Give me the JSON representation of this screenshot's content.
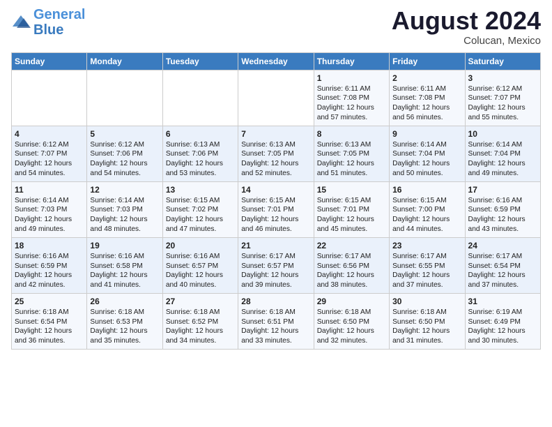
{
  "header": {
    "logo_line1": "General",
    "logo_line2": "Blue",
    "main_title": "August 2024",
    "subtitle": "Colucan, Mexico"
  },
  "days_of_week": [
    "Sunday",
    "Monday",
    "Tuesday",
    "Wednesday",
    "Thursday",
    "Friday",
    "Saturday"
  ],
  "weeks": [
    [
      {
        "day": "",
        "text": ""
      },
      {
        "day": "",
        "text": ""
      },
      {
        "day": "",
        "text": ""
      },
      {
        "day": "",
        "text": ""
      },
      {
        "day": "1",
        "text": "Sunrise: 6:11 AM\nSunset: 7:08 PM\nDaylight: 12 hours and 57 minutes."
      },
      {
        "day": "2",
        "text": "Sunrise: 6:11 AM\nSunset: 7:08 PM\nDaylight: 12 hours and 56 minutes."
      },
      {
        "day": "3",
        "text": "Sunrise: 6:12 AM\nSunset: 7:07 PM\nDaylight: 12 hours and 55 minutes."
      }
    ],
    [
      {
        "day": "4",
        "text": "Sunrise: 6:12 AM\nSunset: 7:07 PM\nDaylight: 12 hours and 54 minutes."
      },
      {
        "day": "5",
        "text": "Sunrise: 6:12 AM\nSunset: 7:06 PM\nDaylight: 12 hours and 54 minutes."
      },
      {
        "day": "6",
        "text": "Sunrise: 6:13 AM\nSunset: 7:06 PM\nDaylight: 12 hours and 53 minutes."
      },
      {
        "day": "7",
        "text": "Sunrise: 6:13 AM\nSunset: 7:05 PM\nDaylight: 12 hours and 52 minutes."
      },
      {
        "day": "8",
        "text": "Sunrise: 6:13 AM\nSunset: 7:05 PM\nDaylight: 12 hours and 51 minutes."
      },
      {
        "day": "9",
        "text": "Sunrise: 6:14 AM\nSunset: 7:04 PM\nDaylight: 12 hours and 50 minutes."
      },
      {
        "day": "10",
        "text": "Sunrise: 6:14 AM\nSunset: 7:04 PM\nDaylight: 12 hours and 49 minutes."
      }
    ],
    [
      {
        "day": "11",
        "text": "Sunrise: 6:14 AM\nSunset: 7:03 PM\nDaylight: 12 hours and 49 minutes."
      },
      {
        "day": "12",
        "text": "Sunrise: 6:14 AM\nSunset: 7:03 PM\nDaylight: 12 hours and 48 minutes."
      },
      {
        "day": "13",
        "text": "Sunrise: 6:15 AM\nSunset: 7:02 PM\nDaylight: 12 hours and 47 minutes."
      },
      {
        "day": "14",
        "text": "Sunrise: 6:15 AM\nSunset: 7:01 PM\nDaylight: 12 hours and 46 minutes."
      },
      {
        "day": "15",
        "text": "Sunrise: 6:15 AM\nSunset: 7:01 PM\nDaylight: 12 hours and 45 minutes."
      },
      {
        "day": "16",
        "text": "Sunrise: 6:15 AM\nSunset: 7:00 PM\nDaylight: 12 hours and 44 minutes."
      },
      {
        "day": "17",
        "text": "Sunrise: 6:16 AM\nSunset: 6:59 PM\nDaylight: 12 hours and 43 minutes."
      }
    ],
    [
      {
        "day": "18",
        "text": "Sunrise: 6:16 AM\nSunset: 6:59 PM\nDaylight: 12 hours and 42 minutes."
      },
      {
        "day": "19",
        "text": "Sunrise: 6:16 AM\nSunset: 6:58 PM\nDaylight: 12 hours and 41 minutes."
      },
      {
        "day": "20",
        "text": "Sunrise: 6:16 AM\nSunset: 6:57 PM\nDaylight: 12 hours and 40 minutes."
      },
      {
        "day": "21",
        "text": "Sunrise: 6:17 AM\nSunset: 6:57 PM\nDaylight: 12 hours and 39 minutes."
      },
      {
        "day": "22",
        "text": "Sunrise: 6:17 AM\nSunset: 6:56 PM\nDaylight: 12 hours and 38 minutes."
      },
      {
        "day": "23",
        "text": "Sunrise: 6:17 AM\nSunset: 6:55 PM\nDaylight: 12 hours and 37 minutes."
      },
      {
        "day": "24",
        "text": "Sunrise: 6:17 AM\nSunset: 6:54 PM\nDaylight: 12 hours and 37 minutes."
      }
    ],
    [
      {
        "day": "25",
        "text": "Sunrise: 6:18 AM\nSunset: 6:54 PM\nDaylight: 12 hours and 36 minutes."
      },
      {
        "day": "26",
        "text": "Sunrise: 6:18 AM\nSunset: 6:53 PM\nDaylight: 12 hours and 35 minutes."
      },
      {
        "day": "27",
        "text": "Sunrise: 6:18 AM\nSunset: 6:52 PM\nDaylight: 12 hours and 34 minutes."
      },
      {
        "day": "28",
        "text": "Sunrise: 6:18 AM\nSunset: 6:51 PM\nDaylight: 12 hours and 33 minutes."
      },
      {
        "day": "29",
        "text": "Sunrise: 6:18 AM\nSunset: 6:50 PM\nDaylight: 12 hours and 32 minutes."
      },
      {
        "day": "30",
        "text": "Sunrise: 6:18 AM\nSunset: 6:50 PM\nDaylight: 12 hours and 31 minutes."
      },
      {
        "day": "31",
        "text": "Sunrise: 6:19 AM\nSunset: 6:49 PM\nDaylight: 12 hours and 30 minutes."
      }
    ]
  ]
}
